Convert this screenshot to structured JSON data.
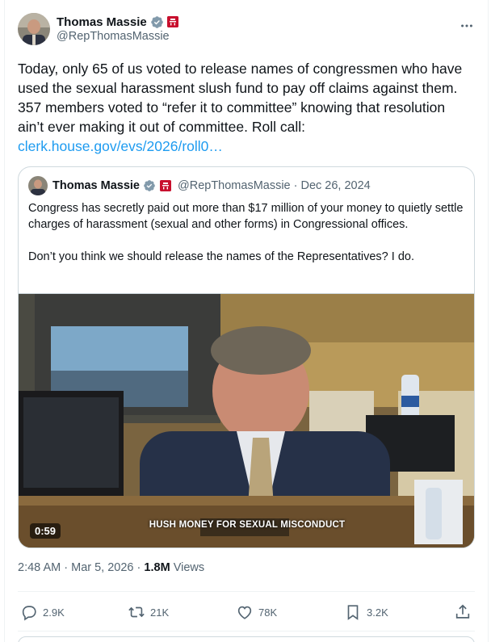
{
  "author": {
    "name": "Thomas Massie",
    "handle": "@RepThomasMassie",
    "verified_icon": "verified-badge-icon",
    "flag_icon": "us-house-flag-icon",
    "more_icon": "more-horizontal-icon"
  },
  "post": {
    "text": "Today, only 65 of us voted to release names of congressmen who have used the sexual harassment slush fund to pay off claims against them. 357 members voted to “refer it to committee” knowing that resolution ain’t ever making it out of committee. Roll call:",
    "link": "clerk.house.gov/evs/2026/roll0…"
  },
  "quoted": {
    "name": "Thomas Massie",
    "handle": "@RepThomasMassie",
    "separator": "·",
    "date": "Dec 26, 2024",
    "paragraphs": [
      "Congress has secretly paid out more than $17 million of your money to quietly settle charges of harassment (sexual and other forms) in  Congressional offices.",
      "Don’t you think we should release the names of the Representatives? I do."
    ],
    "video": {
      "duration": "0:59",
      "caption": "HUSH MONEY FOR SEXUAL MISCONDUCT",
      "nameplate": "MR. MASSIE"
    }
  },
  "meta": {
    "time": "2:48 AM",
    "dot1": "·",
    "date": "Mar 5, 2026",
    "dot2": "·",
    "views_count": "1.8M",
    "views_label": "Views"
  },
  "actions": {
    "replies": "2.9K",
    "reposts": "21K",
    "likes": "78K",
    "bookmarks": "3.2K"
  },
  "colors": {
    "accent": "#1d9bf0",
    "text": "#0f1419",
    "muted": "#536471",
    "border": "#cfd9de"
  }
}
